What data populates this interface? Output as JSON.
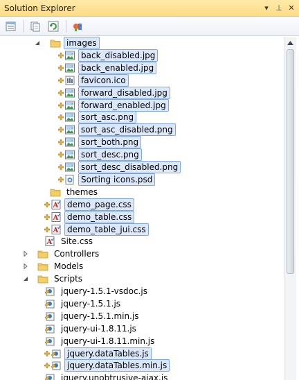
{
  "window": {
    "title": "Solution Explorer"
  },
  "titlebar": {
    "pin_glyph": "▾",
    "autohide_glyph": "⊥",
    "close_glyph": "✕"
  },
  "toolbar": {
    "buttons": [
      {
        "name": "properties-icon"
      },
      {
        "name": "show-all-files-icon"
      },
      {
        "name": "refresh-icon"
      },
      {
        "name": "view-class-diagram-icon"
      }
    ]
  },
  "colors": {
    "selection_bg": "#dbe8fb",
    "selection_border": "#7ea8e1",
    "folder": "#f3cf68",
    "css_red": "#c0272d",
    "js_blue": "#3a78c9"
  },
  "tree": {
    "images_folder": "images",
    "images_files": [
      {
        "label": "back_disabled.jpg",
        "kind": "image"
      },
      {
        "label": "back_enabled.jpg",
        "kind": "image"
      },
      {
        "label": "favicon.ico",
        "kind": "ico"
      },
      {
        "label": "forward_disabled.jpg",
        "kind": "image"
      },
      {
        "label": "forward_enabled.jpg",
        "kind": "image"
      },
      {
        "label": "sort_asc.png",
        "kind": "image"
      },
      {
        "label": "sort_asc_disabled.png",
        "kind": "image"
      },
      {
        "label": "sort_both.png",
        "kind": "image"
      },
      {
        "label": "sort_desc.png",
        "kind": "image"
      },
      {
        "label": "sort_desc_disabled.png",
        "kind": "image"
      },
      {
        "label": "Sorting icons.psd",
        "kind": "psd"
      }
    ],
    "themes_folder": "themes",
    "content_files": [
      {
        "label": "demo_page.css"
      },
      {
        "label": "demo_table.css"
      },
      {
        "label": "demo_table_jui.css"
      },
      {
        "label": "Site.css"
      }
    ],
    "top_folders": [
      "Controllers",
      "Models",
      "Scripts"
    ],
    "script_files": [
      {
        "label": "jquery-1.5.1-vsdoc.js"
      },
      {
        "label": "jquery-1.5.1.js"
      },
      {
        "label": "jquery-1.5.1.min.js"
      },
      {
        "label": "jquery-ui-1.8.11.js"
      },
      {
        "label": "jquery-ui-1.8.11.min.js"
      },
      {
        "label": "jquery.dataTables.js"
      },
      {
        "label": "jquery.dataTables.min.js"
      },
      {
        "label": "jquery.unobtrusive-ajax.js"
      }
    ]
  }
}
